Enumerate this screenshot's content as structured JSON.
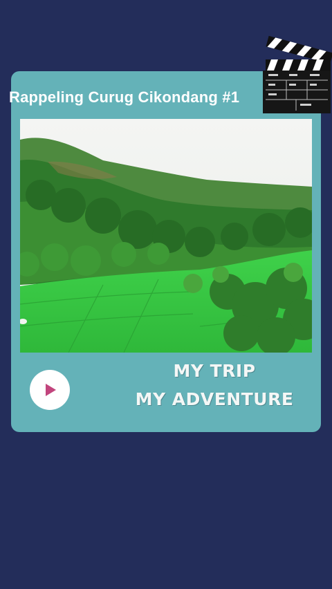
{
  "post": {
    "title": "Rappeling Curug Cikondang #1",
    "tagline_line1": "MY TRIP",
    "tagline_line2": "MY ADVENTURE"
  },
  "icons": {
    "play": "play-icon",
    "clapperboard": "clapperboard-icon"
  },
  "colors": {
    "background": "#232d5a",
    "card": "#64b2b8",
    "play_accent": "#c2457d",
    "text": "#ffffff"
  }
}
